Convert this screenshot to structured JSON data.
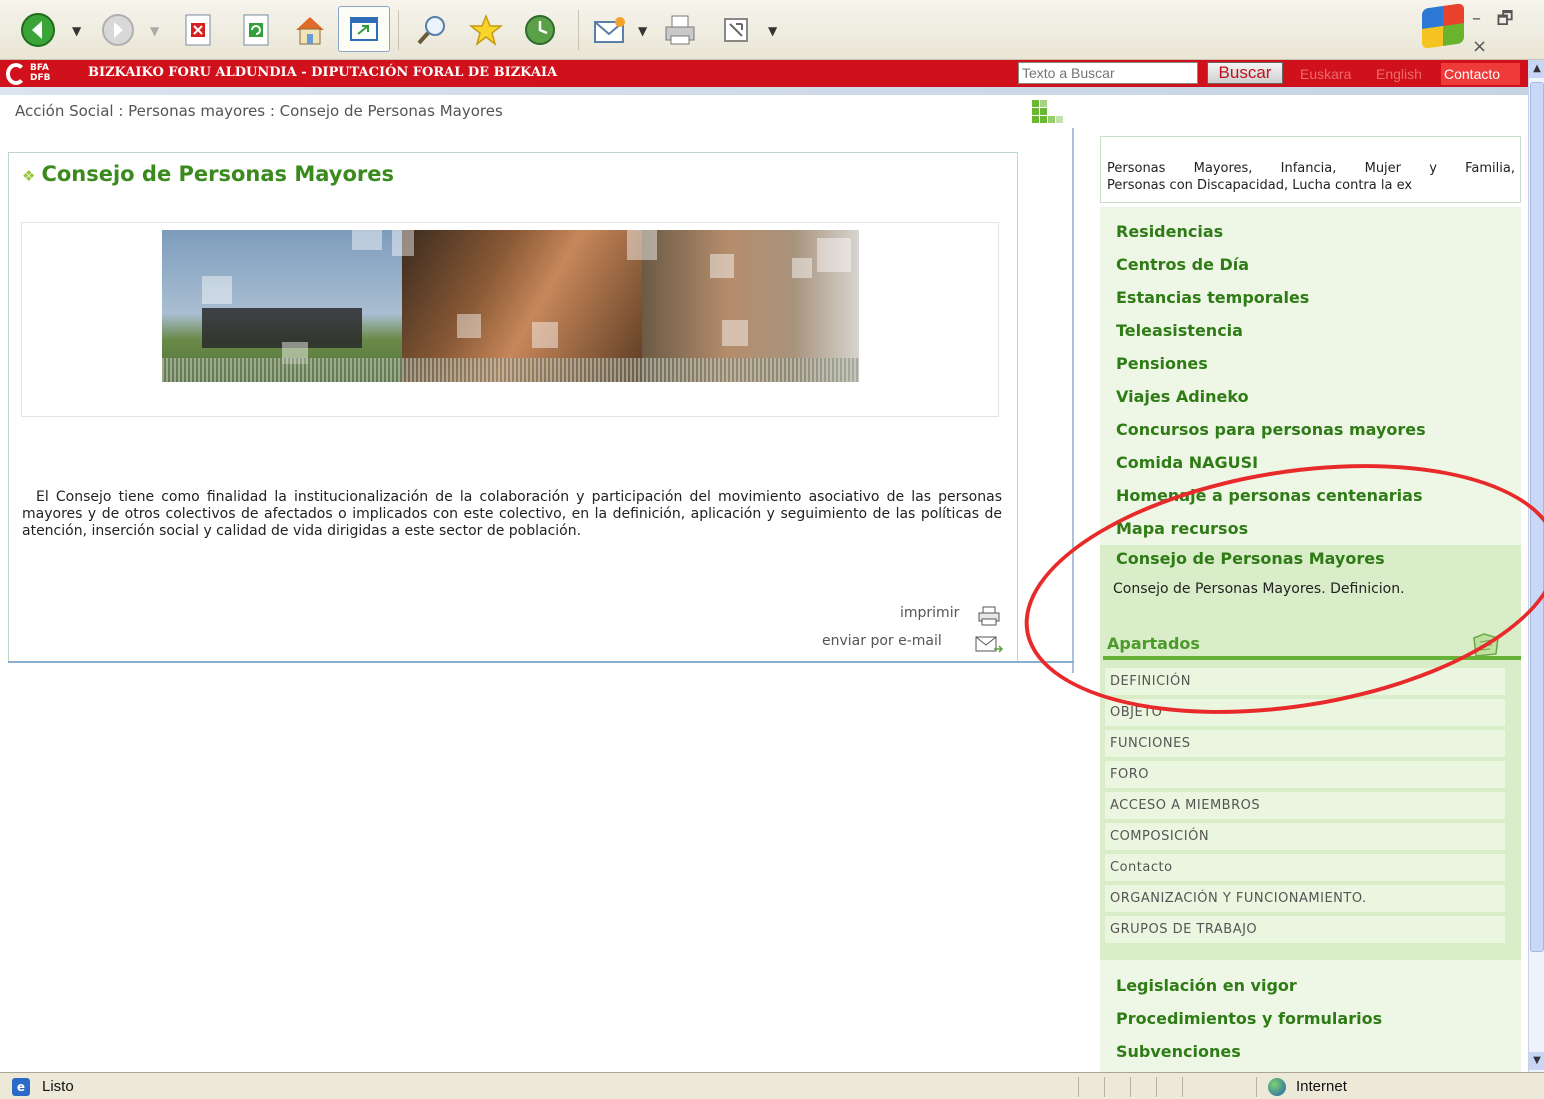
{
  "browser": {
    "toolbar_icons": [
      "back-icon",
      "forward-icon",
      "stop-icon",
      "refresh-icon",
      "home-icon",
      "media-icon",
      "search-icon",
      "favorites-icon",
      "history-icon",
      "mail-icon",
      "print-icon",
      "edit-icon"
    ]
  },
  "header": {
    "logo_text": "BFA DFB",
    "site_title": "BIZKAIKO FORU ALDUNDIA - DIPUTACIÓN FORAL DE BIZKAIA",
    "search_placeholder": "Texto a Buscar",
    "search_button": "Buscar",
    "lang_euskara": "Euskara",
    "lang_english": "English",
    "contact": "Contacto"
  },
  "breadcrumb": "Acción Social : Personas mayores : Consejo de Personas Mayores",
  "main": {
    "title": "Consejo de Personas Mayores",
    "description": "El Consejo tiene como finalidad la institucionalización de la colaboración y participación del movimiento asociativo de las personas mayores y de otros colectivos de afectados o implicados con este colectivo, en la definición, aplicación y seguimiento de las políticas de atención, inserción social y calidad de vida dirigidas a este sector de población.",
    "print": "imprimir",
    "email": "enviar por e-mail"
  },
  "sidebar": {
    "summary_line1": "Personas Mayores, Infancia, Mujer y Familia,",
    "summary_line2": "Personas con Discapacidad, Lucha contra la ex",
    "menu": [
      "Residencias",
      "Centros de Día",
      "Estancias temporales",
      "Teleasistencia",
      "Pensiones",
      "Viajes Adineko",
      "Concursos para personas mayores",
      "Comida NAGUSI",
      "Homenaje a personas centenarias",
      "Mapa recursos"
    ],
    "active_item": "Consejo de Personas Mayores",
    "active_desc": "Consejo de Personas Mayores. Definicion.",
    "apartados_title": "Apartados",
    "apartados": [
      "DEFINICIÓN",
      "OBJETO",
      "FUNCIONES",
      "FORO",
      "ACCESO A MIEMBROS",
      "COMPOSICIÓN",
      "Contacto",
      "ORGANIZACIÓN Y FUNCIONAMIENTO.",
      "GRUPOS DE TRABAJO"
    ],
    "bottom_menu": [
      "Legislación en vigor",
      "Procedimientos y formularios",
      "Subvenciones"
    ]
  },
  "status": {
    "text": "Listo",
    "zone": "Internet"
  },
  "colors": {
    "brand_red": "#d0101a",
    "menu_green": "#2f7b16",
    "active_bg": "#d9edc9",
    "annotation": "#e82a2a"
  }
}
